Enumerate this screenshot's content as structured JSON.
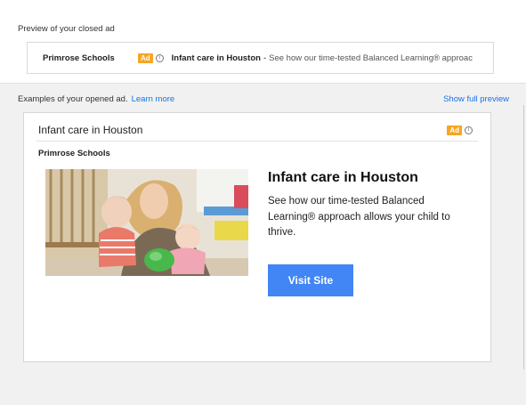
{
  "closed_preview": {
    "label": "Preview of your closed ad",
    "advertiser": "Primrose Schools",
    "badge": "Ad",
    "headline": "Infant care in Houston",
    "separator": "-",
    "description": "See how our time-tested Balanced Learning® approac"
  },
  "opened_preview": {
    "label": "Examples of your opened ad.",
    "learn_more": "Learn more",
    "show_full_preview": "Show full preview"
  },
  "opened_ad": {
    "header_title": "Infant care in Houston",
    "badge": "Ad",
    "advertiser": "Primrose Schools",
    "headline": "Infant care in Houston",
    "description": "See how our time-tested Balanced Learning® approach allows your child to thrive.",
    "cta_label": "Visit Site",
    "image_subject": "teacher-with-infants-photo"
  },
  "colors": {
    "badge": "#f5a623",
    "link": "#1a73e8",
    "cta": "#4285f4",
    "background": "#f1f1f1"
  },
  "icons": [
    "info-icon"
  ]
}
